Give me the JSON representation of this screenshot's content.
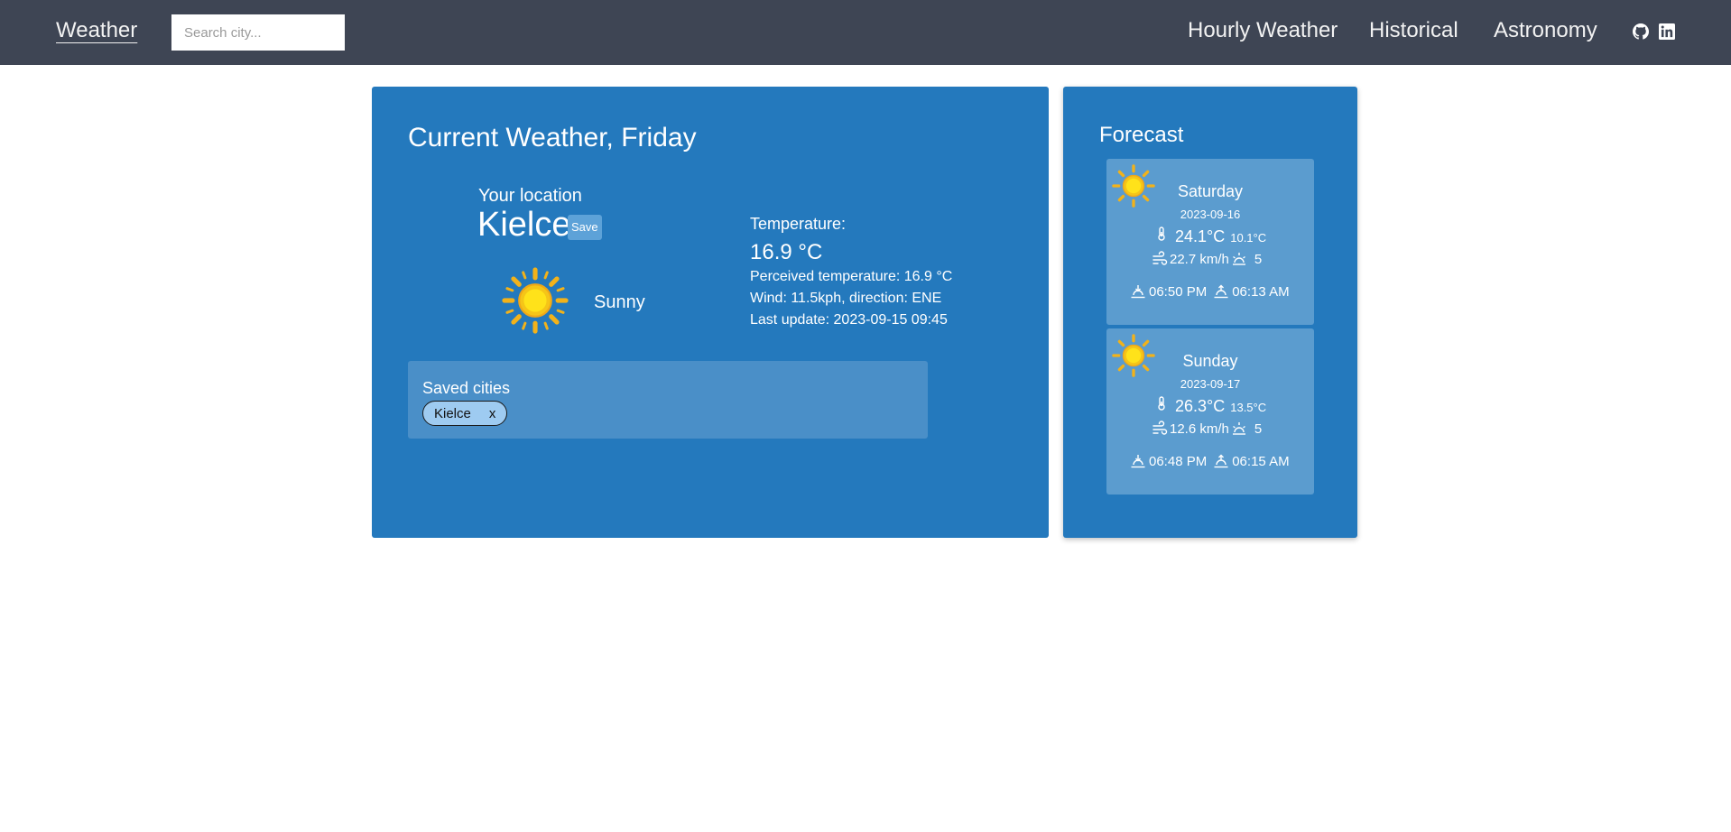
{
  "navbar": {
    "brand": "Weather",
    "search_placeholder": "Search city...",
    "links": [
      "Hourly Weather",
      "Historical",
      "Astronomy"
    ],
    "icons": [
      "github-icon",
      "linkedin-icon"
    ]
  },
  "current": {
    "title": "Current Weather, Friday",
    "location_label": "Your location",
    "city": "Kielce",
    "save_label": "Save",
    "condition": "Sunny",
    "condition_icon": "sun-icon",
    "temperature_label": "Temperature:",
    "temperature": "16.9 °C",
    "perceived": "Perceived temperature: 16.9 °C",
    "wind": "Wind: 11.5kph, direction: ENE",
    "last_update": "Last update: 2023-09-15 09:45"
  },
  "saved": {
    "title": "Saved cities",
    "cities": [
      {
        "name": "Kielce",
        "remove": "x"
      }
    ]
  },
  "forecast": {
    "title": "Forecast",
    "days": [
      {
        "day": "Saturday",
        "date": "2023-09-16",
        "max": "24.1°C",
        "min": "10.1°C",
        "wind": "22.7 km/h",
        "uv": "5",
        "sunset": "06:50 PM",
        "sunrise": "06:13 AM"
      },
      {
        "day": "Sunday",
        "date": "2023-09-17",
        "max": "26.3°C",
        "min": "13.5°C",
        "wind": "12.6 km/h",
        "uv": "5",
        "sunset": "06:48 PM",
        "sunrise": "06:15 AM"
      }
    ]
  },
  "colors": {
    "navbar": "#3e4554",
    "card": "#2479bd",
    "saved_box": "#4a8fc8",
    "forecast_day": "#5b9ccf",
    "chip": "#9ecbf1",
    "sun": "#f6c21c"
  }
}
